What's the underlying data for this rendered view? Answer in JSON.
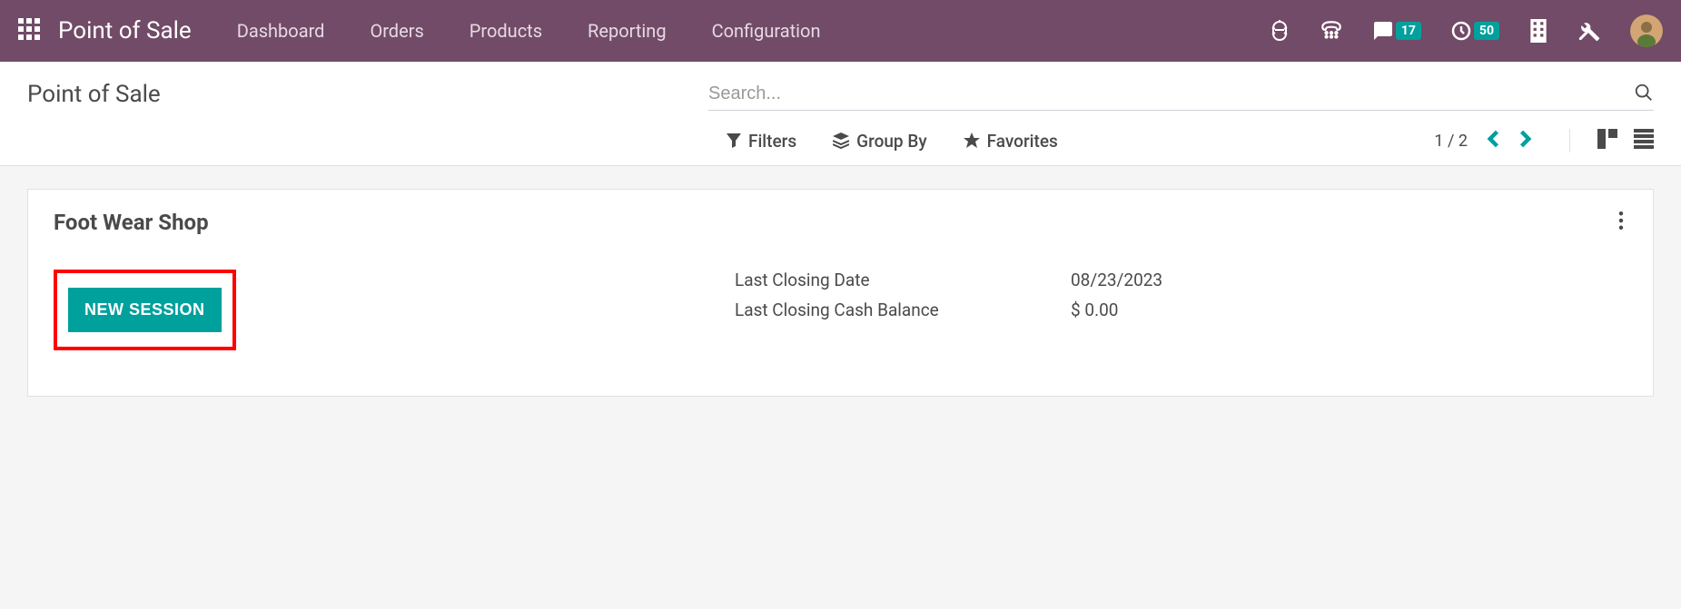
{
  "header": {
    "app_title": "Point of Sale",
    "nav_items": [
      "Dashboard",
      "Orders",
      "Products",
      "Reporting",
      "Configuration"
    ],
    "badges": {
      "messages": "17",
      "activities": "50"
    }
  },
  "control_panel": {
    "breadcrumb_title": "Point of Sale",
    "search_placeholder": "Search...",
    "filters_label": "Filters",
    "groupby_label": "Group By",
    "favorites_label": "Favorites",
    "pager": "1 / 2"
  },
  "card": {
    "title": "Foot Wear Shop",
    "button_label": "NEW SESSION",
    "info": [
      {
        "label": "Last Closing Date",
        "value": "08/23/2023"
      },
      {
        "label": "Last Closing Cash Balance",
        "value": "$ 0.00"
      }
    ]
  }
}
